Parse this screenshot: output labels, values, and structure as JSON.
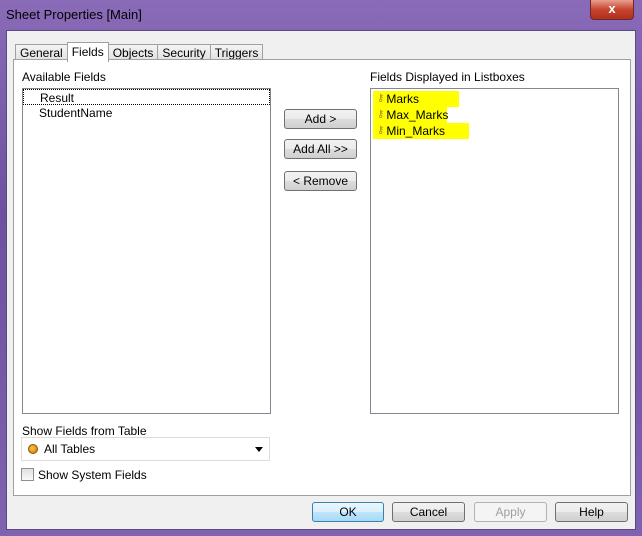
{
  "window": {
    "title": "Sheet Properties [Main]",
    "close": "x"
  },
  "tabs": [
    "General",
    "Fields",
    "Objects",
    "Security",
    "Triggers"
  ],
  "available": {
    "label": "Available Fields",
    "items": [
      "Result",
      "StudentName"
    ]
  },
  "displayed": {
    "label": "Fields Displayed in Listboxes",
    "items": [
      "Marks",
      "Max_Marks",
      "Min_Marks"
    ],
    "highlight_color": "#ffff00"
  },
  "buttons": {
    "add": "Add >",
    "add_all": "Add All >>",
    "remove": "< Remove",
    "ok": "OK",
    "cancel": "Cancel",
    "apply": "Apply",
    "help": "Help"
  },
  "table_filter": {
    "label": "Show Fields from Table",
    "value": "All Tables"
  },
  "system_fields": {
    "label": "Show System Fields",
    "checked": false
  }
}
